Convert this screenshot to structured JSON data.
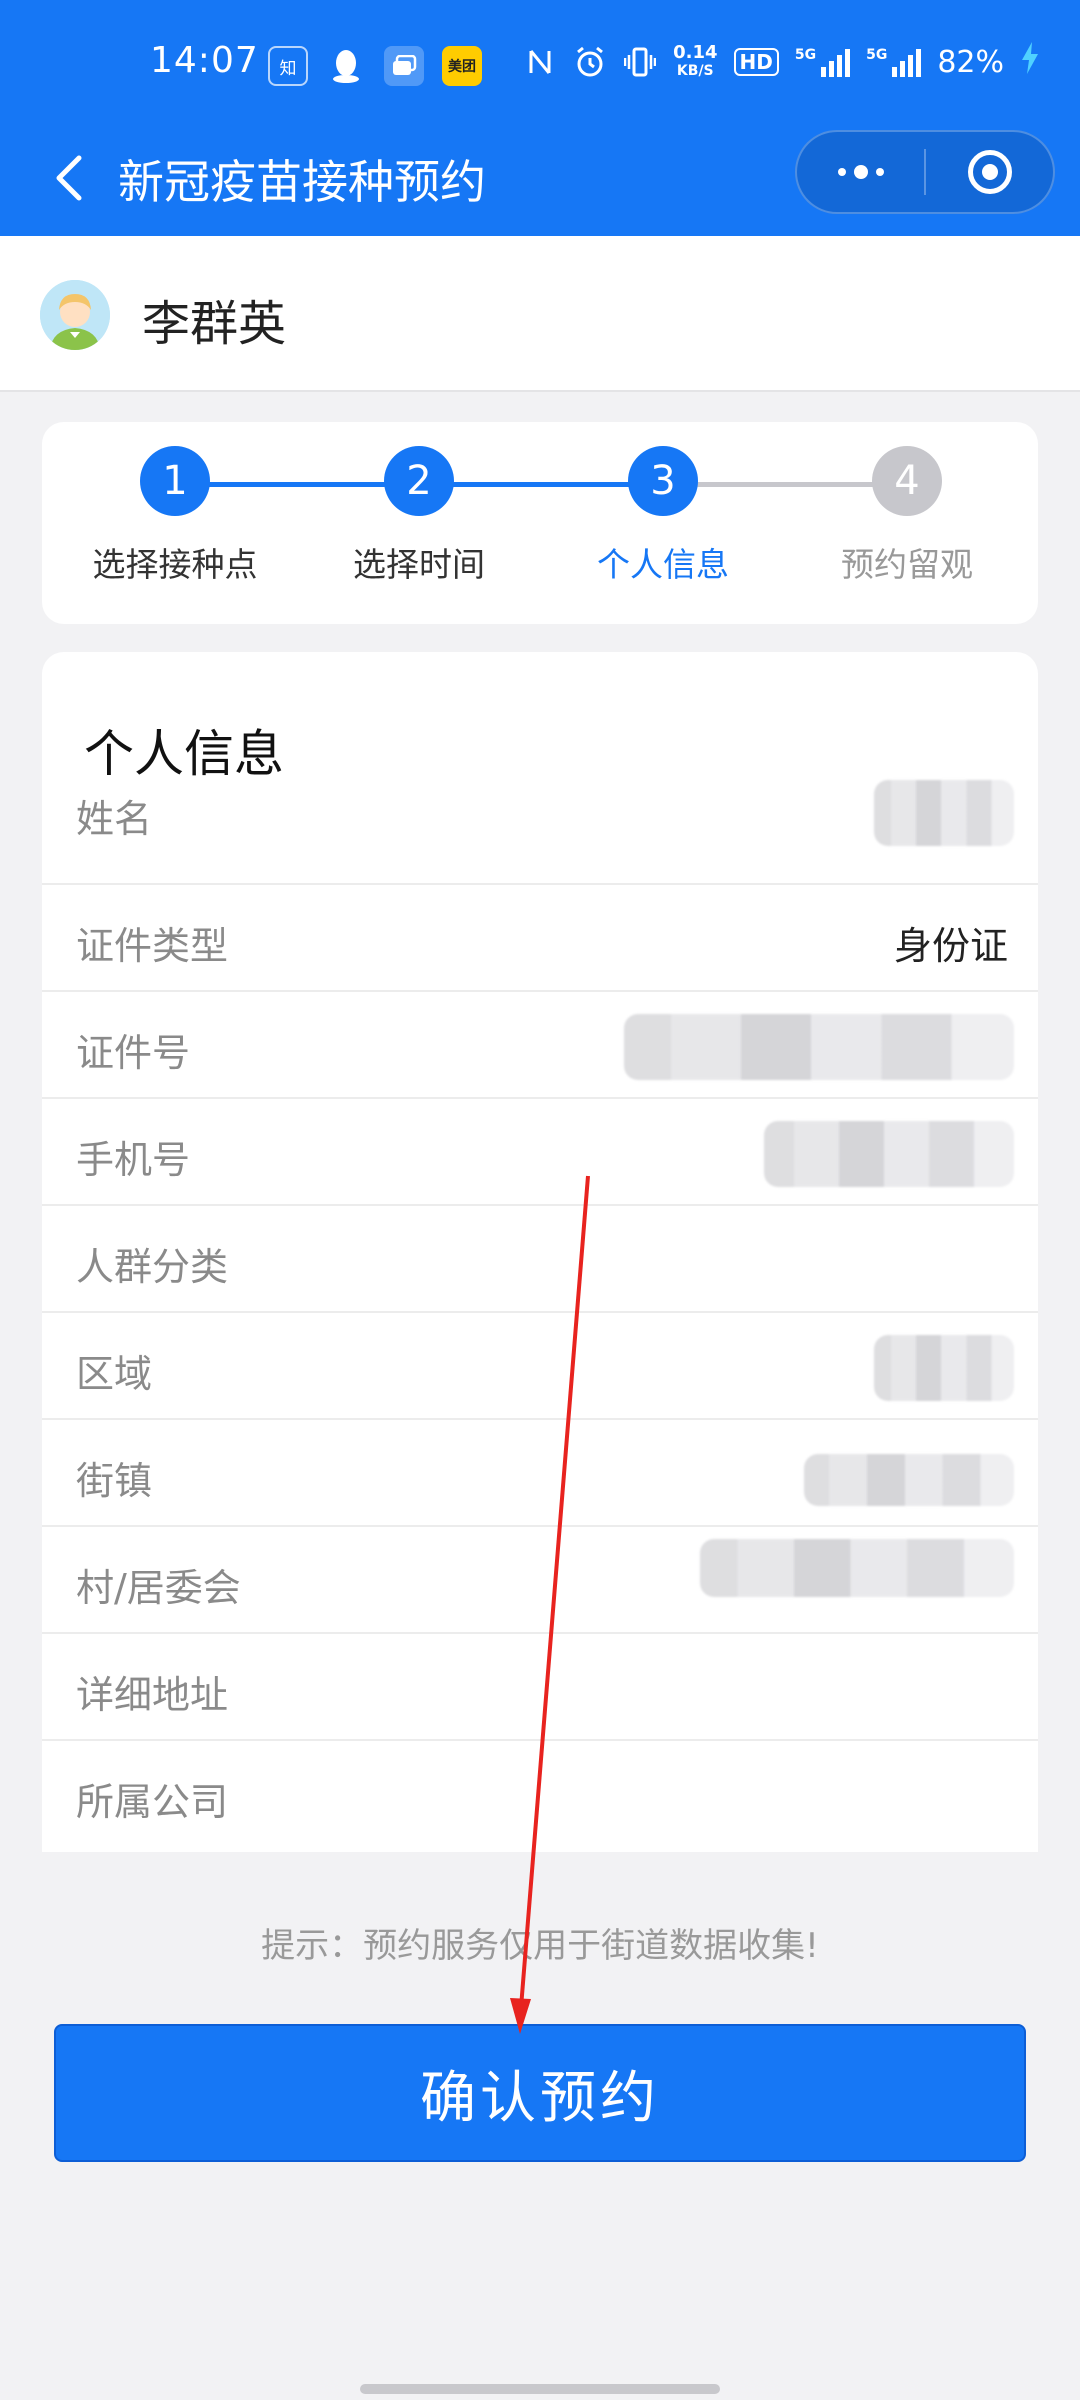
{
  "status_bar": {
    "time": "14:07",
    "apps": [
      "知",
      "QQ",
      "多任务",
      "美团"
    ],
    "speed_value": "0.14",
    "speed_unit": "KB/S",
    "hd_label": "HD",
    "net1": "5G",
    "net2": "5G",
    "battery": "82%"
  },
  "header": {
    "title": "新冠疫苗接种预约",
    "colors": {
      "primary": "#1677f5",
      "inactive": "#c7c7cc",
      "text_active": "#1677f5"
    }
  },
  "user": {
    "name": "李群英"
  },
  "steps": [
    {
      "number": "1",
      "label": "选择接种点",
      "state": "done"
    },
    {
      "number": "2",
      "label": "选择时间",
      "state": "done"
    },
    {
      "number": "3",
      "label": "个人信息",
      "state": "active"
    },
    {
      "number": "4",
      "label": "预约留观",
      "state": "pending"
    }
  ],
  "info": {
    "title": "个人信息",
    "rows": [
      {
        "label": "姓名",
        "value": "",
        "redacted": true
      },
      {
        "label": "证件类型",
        "value": "身份证",
        "redacted": false
      },
      {
        "label": "证件号",
        "value": "",
        "redacted": true
      },
      {
        "label": "手机号",
        "value": "",
        "redacted": true
      },
      {
        "label": "人群分类",
        "value": "",
        "redacted": false
      },
      {
        "label": "区域",
        "value": "",
        "redacted": true
      },
      {
        "label": "街镇",
        "value": "",
        "redacted": true
      },
      {
        "label": "村/居委会",
        "value": "",
        "redacted": true
      },
      {
        "label": "详细地址",
        "value": "",
        "redacted": false
      },
      {
        "label": "所属公司",
        "value": "",
        "redacted": false
      }
    ]
  },
  "hint": "提示：预约服务仅用于街道数据收集!",
  "confirm_button": "确认预约"
}
